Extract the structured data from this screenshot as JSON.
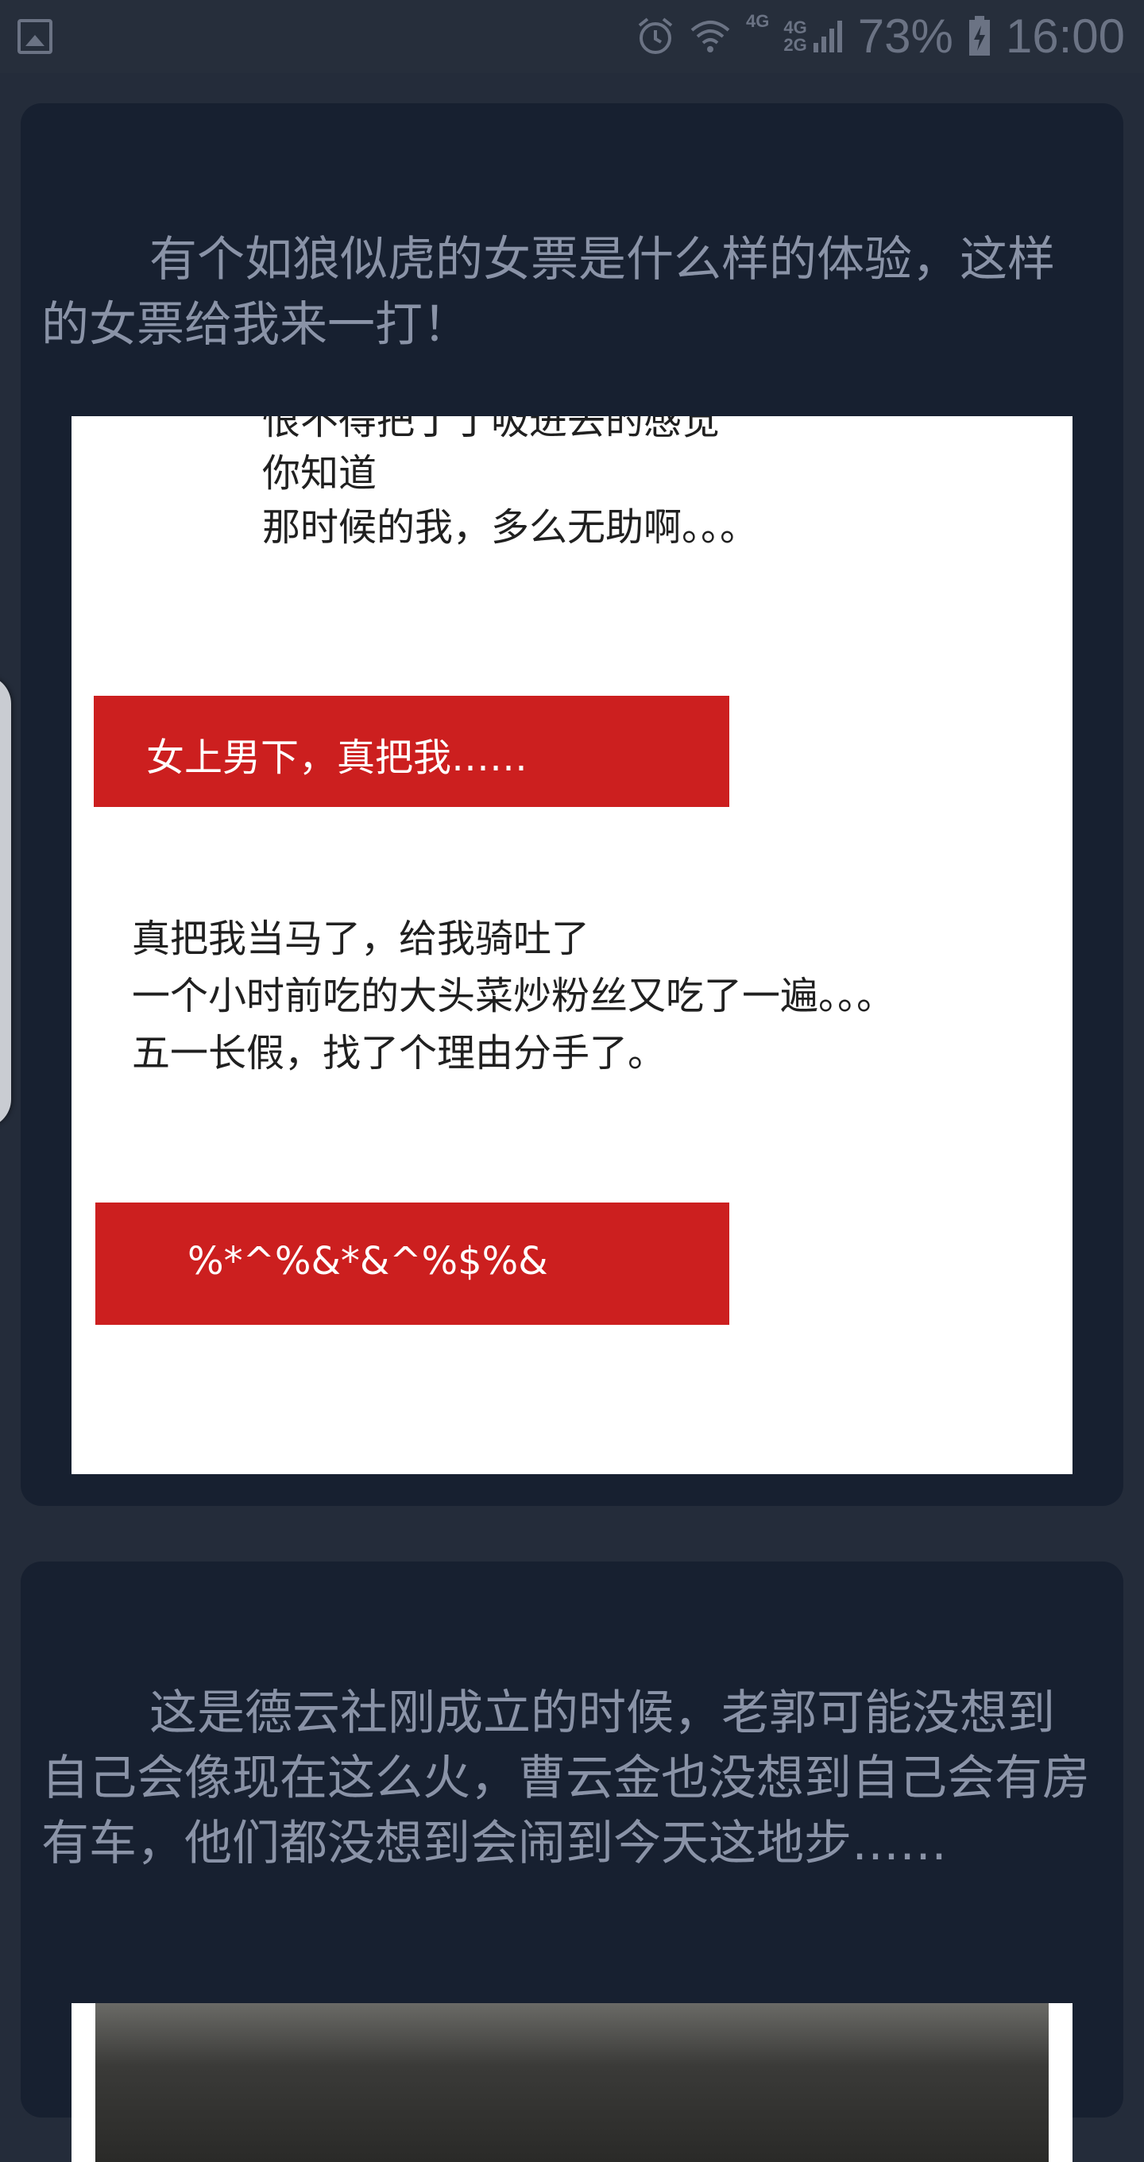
{
  "status_bar": {
    "left_icon": "image-icon",
    "alarm_icon": "alarm-icon",
    "wifi_icon": "wifi-icon",
    "network_1": "4G",
    "network_2_top": "4G",
    "network_2_bottom": "2G",
    "battery_percent": "73%",
    "battery_icon": "battery-charging-icon",
    "time": "16:00"
  },
  "feed": {
    "posts": [
      {
        "text": "有个如狼似虎的女票是什么样的体验，这样的女票给我来一打！",
        "image": {
          "lines_top": [
            "恨不得把丁丁吸进去的感觉",
            "你知道",
            "那时候的我，多么无助啊。。。"
          ],
          "banner_1": "女上男下，真把我……",
          "lines_middle": [
            "真把我当马了，给我骑吐了",
            "一个小时前吃的大头菜炒粉丝又吃了一遍。。。",
            "五一长假，找了个理由分手了。"
          ],
          "banner_2": "%*^%&*&^%$%&"
        }
      },
      {
        "text": "这是德云社刚成立的时候，老郭可能没想到自己会像现在这么火，曹云金也没想到自己会有房有车，他们都没想到会闹到今天这地步……"
      }
    ]
  },
  "colors": {
    "background": "#242c3a",
    "card": "#172030",
    "text": "#8a93a7",
    "banner_red": "#cc1f1f"
  }
}
